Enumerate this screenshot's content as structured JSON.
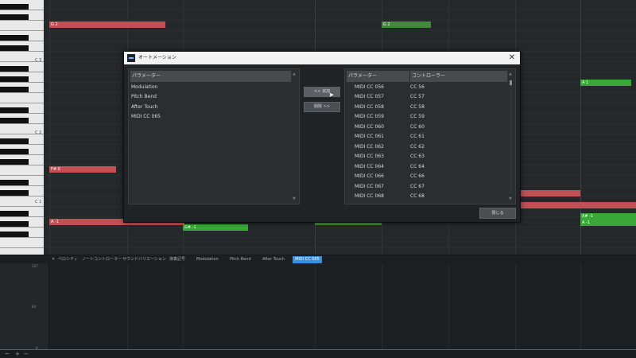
{
  "piano_roll": {
    "c_labels": [
      "C 3",
      "C 2",
      "C 1"
    ],
    "notes": [
      {
        "label": "G 2",
        "color": "red"
      },
      {
        "label": "G 2",
        "color": "green"
      },
      {
        "label": "A 1",
        "color": "green"
      },
      {
        "label": "F# 0",
        "color": "red"
      },
      {
        "label": "A -1",
        "color": "red"
      },
      {
        "label": "G# -1",
        "color": "green"
      },
      {
        "label": "A# -1",
        "color": "green"
      },
      {
        "label": "A -1",
        "color": "green"
      }
    ]
  },
  "automation_tabs": [
    "ベロシティ",
    "ノートコントローラー",
    "サウンドバリエーション",
    "演奏記号",
    "Modulation",
    "Pitch Bend",
    "After Touch",
    "MIDI CC 065"
  ],
  "active_tab": "MIDI CC 065",
  "lane_axis": {
    "top": "127",
    "mid": "64",
    "bottom": "0"
  },
  "dialog": {
    "title": "オートメーション",
    "close_glyph": "✕",
    "left_list": {
      "header": "パラメーター",
      "items": [
        "Modulation",
        "Pitch Bend",
        "After Touch",
        "MIDI CC 065"
      ]
    },
    "add_button": "<< 追加",
    "remove_button": "削除 >>",
    "right_list": {
      "header_param": "パラメーター",
      "header_controller": "コントローラー",
      "rows": [
        {
          "param": "MIDI CC 056",
          "controller": "CC 56"
        },
        {
          "param": "MIDI CC 057",
          "controller": "CC 57"
        },
        {
          "param": "MIDI CC 058",
          "controller": "CC 58"
        },
        {
          "param": "MIDI CC 059",
          "controller": "CC 59"
        },
        {
          "param": "MIDI CC 060",
          "controller": "CC 60"
        },
        {
          "param": "MIDI CC 061",
          "controller": "CC 61"
        },
        {
          "param": "MIDI CC 062",
          "controller": "CC 62"
        },
        {
          "param": "MIDI CC 063",
          "controller": "CC 63"
        },
        {
          "param": "MIDI CC 064",
          "controller": "CC 64"
        },
        {
          "param": "MIDI CC 066",
          "controller": "CC 66"
        },
        {
          "param": "MIDI CC 067",
          "controller": "CC 67"
        },
        {
          "param": "MIDI CC 068",
          "controller": "CC 68"
        }
      ]
    },
    "close_button": "閉じる"
  },
  "bottom_tools": [
    "~",
    "+",
    "−"
  ],
  "colors": {
    "accent": "#3c8ee0",
    "note_red": "#c34f54",
    "note_green": "#3f8b3a"
  }
}
